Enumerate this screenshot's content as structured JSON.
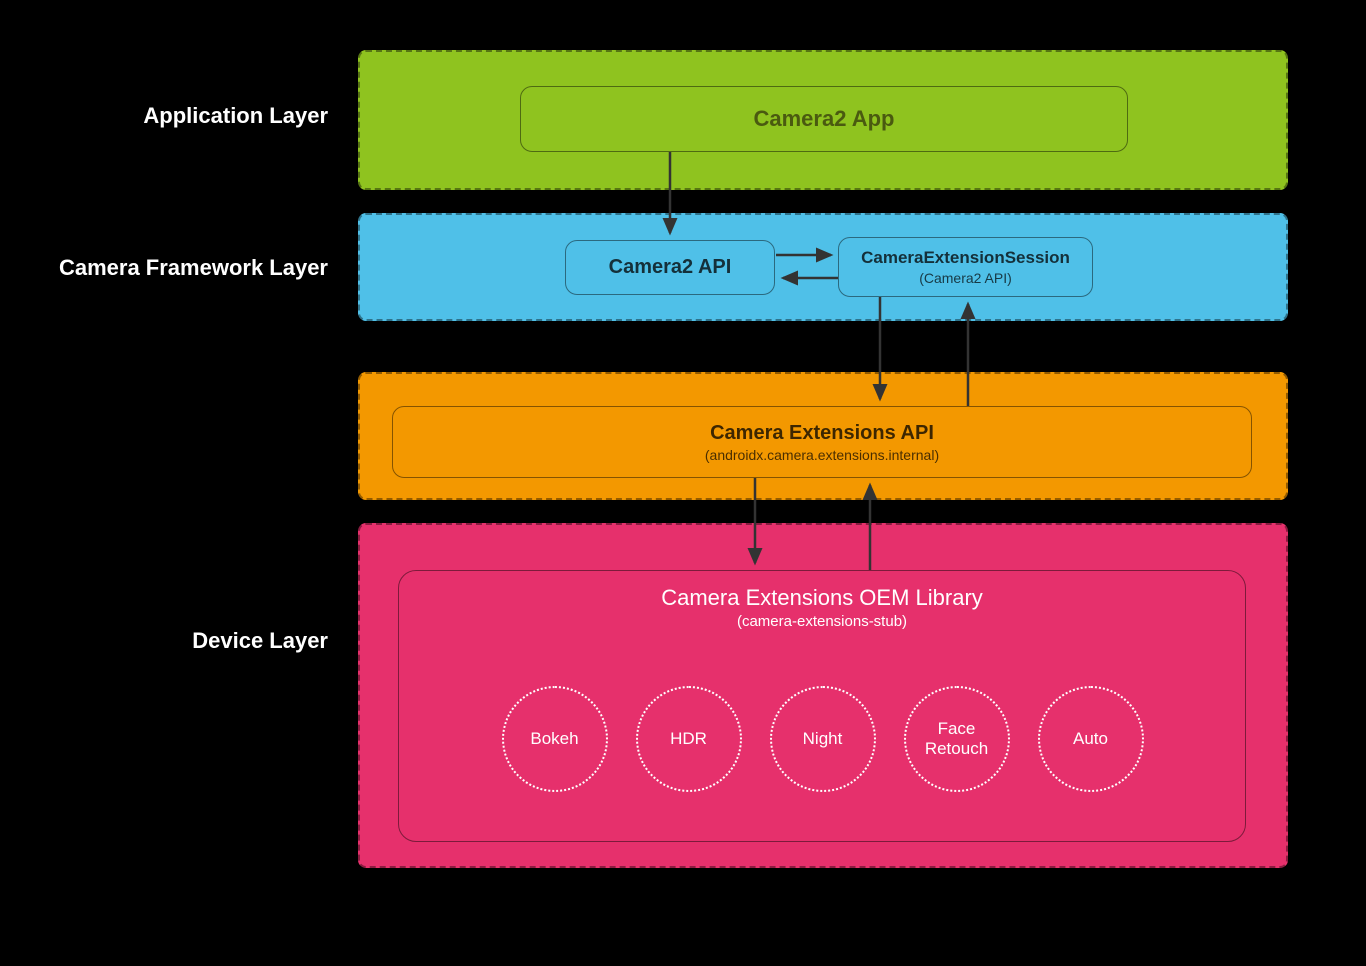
{
  "layers": {
    "application": {
      "label": "Application Layer",
      "box": {
        "title": "Camera2 App"
      },
      "color": "#8fc31f"
    },
    "framework": {
      "label": "Camera Framework Layer",
      "box1": {
        "title": "Camera2 API"
      },
      "box2": {
        "title": "CameraExtensionSession",
        "subtitle": "(Camera2 API)"
      },
      "color": "#4fc0e8"
    },
    "extensions": {
      "label": "",
      "box": {
        "title": "Camera Extensions API",
        "subtitle": "(androidx.camera.extensions.internal)"
      },
      "color": "#f39800"
    },
    "device": {
      "label": "Device Layer",
      "oem": {
        "title": "Camera Extensions OEM Library",
        "subtitle": "(camera-extensions-stub)"
      },
      "features": [
        "Bokeh",
        "HDR",
        "Night",
        "Face\nRetouch",
        "Auto"
      ],
      "color": "#e6306c"
    }
  }
}
